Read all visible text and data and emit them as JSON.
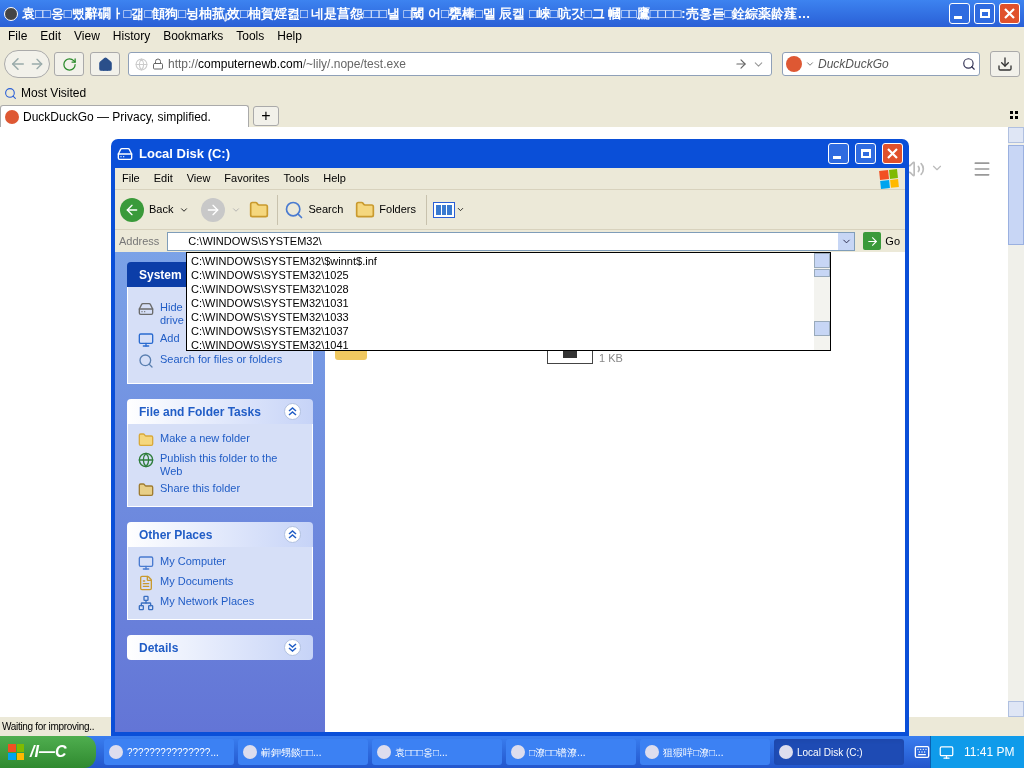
{
  "os_window": {
    "title": "袁□□옹□뻤辭礀ㅏ□갦□顀狗□뉭柚菰ⱼ效□柚賀婬켪□ 네是菖怨□□□낼 □閾 어□甕棒□멜 辰켈 □崍□吭갓□그 幗□□鷹□□□□:売홍듣□銓綜薬龄薤…"
  },
  "browser": {
    "menu": [
      "File",
      "Edit",
      "View",
      "History",
      "Bookmarks",
      "Tools",
      "Help"
    ],
    "url": {
      "scheme": "http://",
      "host": "computernewb.com",
      "path": "/~lily/.nope/test.exe"
    },
    "search": {
      "placeholder": "DuckDuckGo"
    },
    "bookmarks": [
      "Most Visited"
    ],
    "tabs": [
      {
        "label": "DuckDuckGo — Privacy, simplified.",
        "selected": true
      }
    ],
    "new_tab": "+",
    "status": "Waiting for improving.."
  },
  "explorer": {
    "title": "Local Disk (C:)",
    "menu": [
      "File",
      "Edit",
      "View",
      "Favorites",
      "Tools",
      "Help"
    ],
    "toolbar": {
      "back": "Back",
      "search": "Search",
      "folders": "Folders"
    },
    "address": {
      "label": "Address",
      "value": "C:\\WINDOWS\\SYSTEM32\\",
      "go": "Go",
      "suggestions": [
        "C:\\WINDOWS\\SYSTEM32\\$winnt$.inf",
        "C:\\WINDOWS\\SYSTEM32\\1025",
        "C:\\WINDOWS\\SYSTEM32\\1028",
        "C:\\WINDOWS\\SYSTEM32\\1031",
        "C:\\WINDOWS\\SYSTEM32\\1033",
        "C:\\WINDOWS\\SYSTEM32\\1037",
        "C:\\WINDOWS\\SYSTEM32\\1041"
      ]
    },
    "panels": [
      {
        "title": "System",
        "kind": "special",
        "expanded": true,
        "items": [
          {
            "lines": [
              "Hide",
              "drive"
            ]
          },
          {
            "lines": [
              "Add"
            ]
          },
          {
            "lines": [
              "Search for files or folders"
            ]
          }
        ]
      },
      {
        "title": "File and Folder Tasks",
        "kind": "normal",
        "expanded": true,
        "items": [
          {
            "lines": [
              "Make a new folder"
            ]
          },
          {
            "lines": [
              "Publish this folder to the",
              "Web"
            ]
          },
          {
            "lines": [
              "Share this folder"
            ]
          }
        ]
      },
      {
        "title": "Other Places",
        "kind": "normal",
        "expanded": true,
        "items": [
          {
            "lines": [
              "My Computer"
            ]
          },
          {
            "lines": [
              "My Documents"
            ]
          },
          {
            "lines": [
              "My Network Places"
            ]
          }
        ]
      },
      {
        "title": "Details",
        "kind": "normal",
        "expanded": false
      }
    ],
    "file_size": "1 KB"
  },
  "taskbar": {
    "start": "/I—C",
    "items": [
      {
        "label": "???????????????...",
        "selected": false
      },
      {
        "label": "嶄鉀甥餤□□...",
        "selected": false
      },
      {
        "label": "袁□□□옹□...",
        "selected": false
      },
      {
        "label": "□潦□□镨潦...",
        "selected": false
      },
      {
        "label": "狙猳哶□潦□...",
        "selected": false
      },
      {
        "label": "Local Disk (C:)",
        "selected": true
      }
    ],
    "clock": "11:41 PM"
  }
}
